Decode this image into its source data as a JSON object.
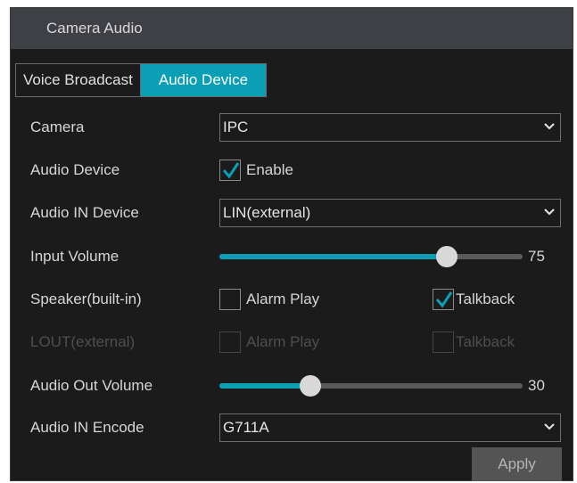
{
  "window": {
    "title": "Camera Audio"
  },
  "tabs": [
    {
      "label": "Voice Broadcast",
      "active": false
    },
    {
      "label": "Audio Device",
      "active": true
    }
  ],
  "form": {
    "camera": {
      "label": "Camera",
      "value": "IPC"
    },
    "audio_device": {
      "label": "Audio Device",
      "enable_label": "Enable",
      "enabled": true
    },
    "audio_in_device": {
      "label": "Audio IN Device",
      "value": "LIN(external)"
    },
    "input_volume": {
      "label": "Input Volume",
      "value": 75,
      "value_text": "75"
    },
    "speaker": {
      "label": "Speaker(built-in)",
      "alarm_play": {
        "label": "Alarm Play",
        "checked": false
      },
      "talkback": {
        "label": "Talkback",
        "checked": true
      }
    },
    "lout": {
      "label": "LOUT(external)",
      "disabled": true,
      "alarm_play": {
        "label": "Alarm Play",
        "checked": false
      },
      "talkback": {
        "label": "Talkback",
        "checked": false
      }
    },
    "audio_out_volume": {
      "label": "Audio Out Volume",
      "value": 30,
      "value_text": "30"
    },
    "audio_in_encode": {
      "label": "Audio IN Encode",
      "value": "G711A"
    }
  },
  "buttons": {
    "apply": "Apply"
  },
  "colors": {
    "accent": "#0a9fb5",
    "panel_bg": "#1b1b1b",
    "titlebar_bg": "#3f3f46",
    "disabled_text": "#4e4e4e"
  },
  "icons": {
    "dropdown": "chevron-down-icon",
    "checked": "checkmark-icon"
  }
}
